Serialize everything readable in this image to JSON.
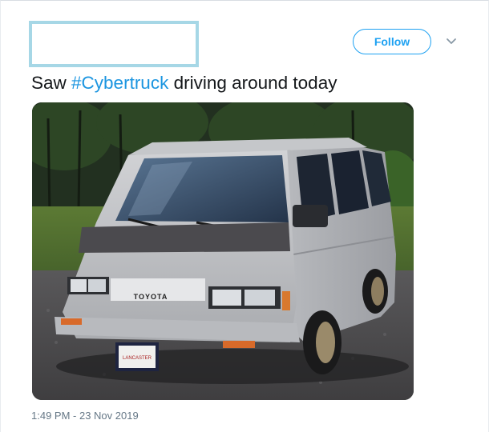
{
  "tweet": {
    "follow_label": "Follow",
    "text_prefix": "Saw ",
    "hashtag": "#Cybertruck",
    "text_suffix": " driving around today",
    "timestamp": "1:49 PM - 23 Nov 2019"
  },
  "media": {
    "brand_badge": "TOYOTA",
    "plate_text": "LANCASTER"
  },
  "icons": {
    "caret": "chevron-down-icon"
  },
  "colors": {
    "accent": "#1da1f2",
    "hashtag": "#1b95e0",
    "text": "#14171a",
    "muted": "#657786",
    "redaction_border": "#a6d7e6"
  }
}
